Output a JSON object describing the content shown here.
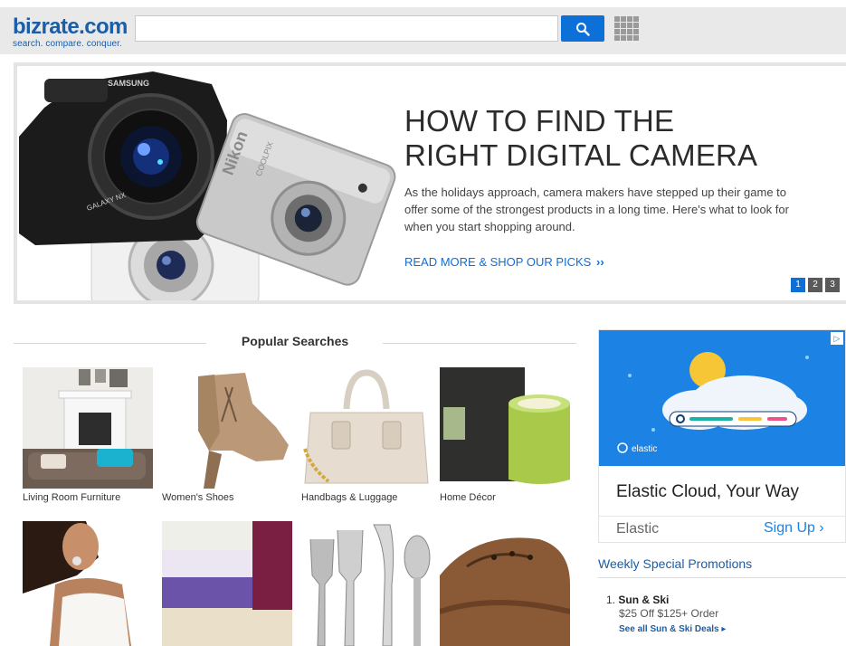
{
  "brand": {
    "logo": "bizrate",
    "logo_suffix": "com",
    "tagline": "search. compare. conquer."
  },
  "search": {
    "value": "",
    "placeholder": ""
  },
  "hero": {
    "title_line1": "HOW TO FIND THE",
    "title_line2": "RIGHT DIGITAL CAMERA",
    "body": "As the holidays approach, camera makers have stepped up their game to offer some of the strongest products in a long time. Here's what to look for when you start shopping around.",
    "link_label": "READ MORE & SHOP OUR PICKS",
    "link_arrow": "››",
    "camera_brands": [
      "SAMSUNG",
      "Nikon",
      "COOLPIX"
    ],
    "camera_model": "GALAXY NX",
    "pager": [
      "1",
      "2",
      "3"
    ],
    "active_page": "1"
  },
  "popular": {
    "title": "Popular Searches",
    "items": [
      {
        "label": "Living Room Furniture"
      },
      {
        "label": "Women's Shoes"
      },
      {
        "label": "Handbags & Luggage"
      },
      {
        "label": "Home Décor"
      },
      {
        "label": ""
      },
      {
        "label": ""
      },
      {
        "label": ""
      },
      {
        "label": ""
      }
    ]
  },
  "ad": {
    "badge": "▷",
    "brand_mark": "elastic",
    "headline": "Elastic Cloud, Your Way",
    "advertiser": "Elastic",
    "cta": "Sign Up",
    "cta_arrow": "›"
  },
  "promotions": {
    "title": "Weekly Special Promotions",
    "items": [
      {
        "num": "1.",
        "name": "Sun & Ski",
        "offer": "$25 Off $125+ Order",
        "link": "See all Sun & Ski Deals",
        "link_arrow": "▸"
      }
    ]
  },
  "colors": {
    "brand": "#1a5da8",
    "accent": "#0d6fd8",
    "ad_bg": "#1c83e4"
  }
}
